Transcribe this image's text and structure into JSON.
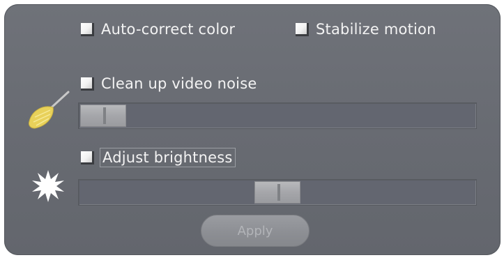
{
  "options": {
    "auto_correct_color": {
      "label": "Auto-correct color",
      "checked": false
    },
    "stabilize_motion": {
      "label": "Stabilize motion",
      "checked": false
    },
    "clean_noise": {
      "label": "Clean up video noise",
      "checked": false,
      "level": 0.04
    },
    "adjust_brightness": {
      "label": "Adjust brightness",
      "checked": false,
      "level": 0.5
    }
  },
  "icons": {
    "noise": "broom-icon",
    "brightness": "sun-icon"
  },
  "apply_button": {
    "label": "Apply",
    "enabled": false
  },
  "colors": {
    "panel": "#6b6e75",
    "text": "#f3f3f3",
    "broom_head": "#e8d15a"
  }
}
